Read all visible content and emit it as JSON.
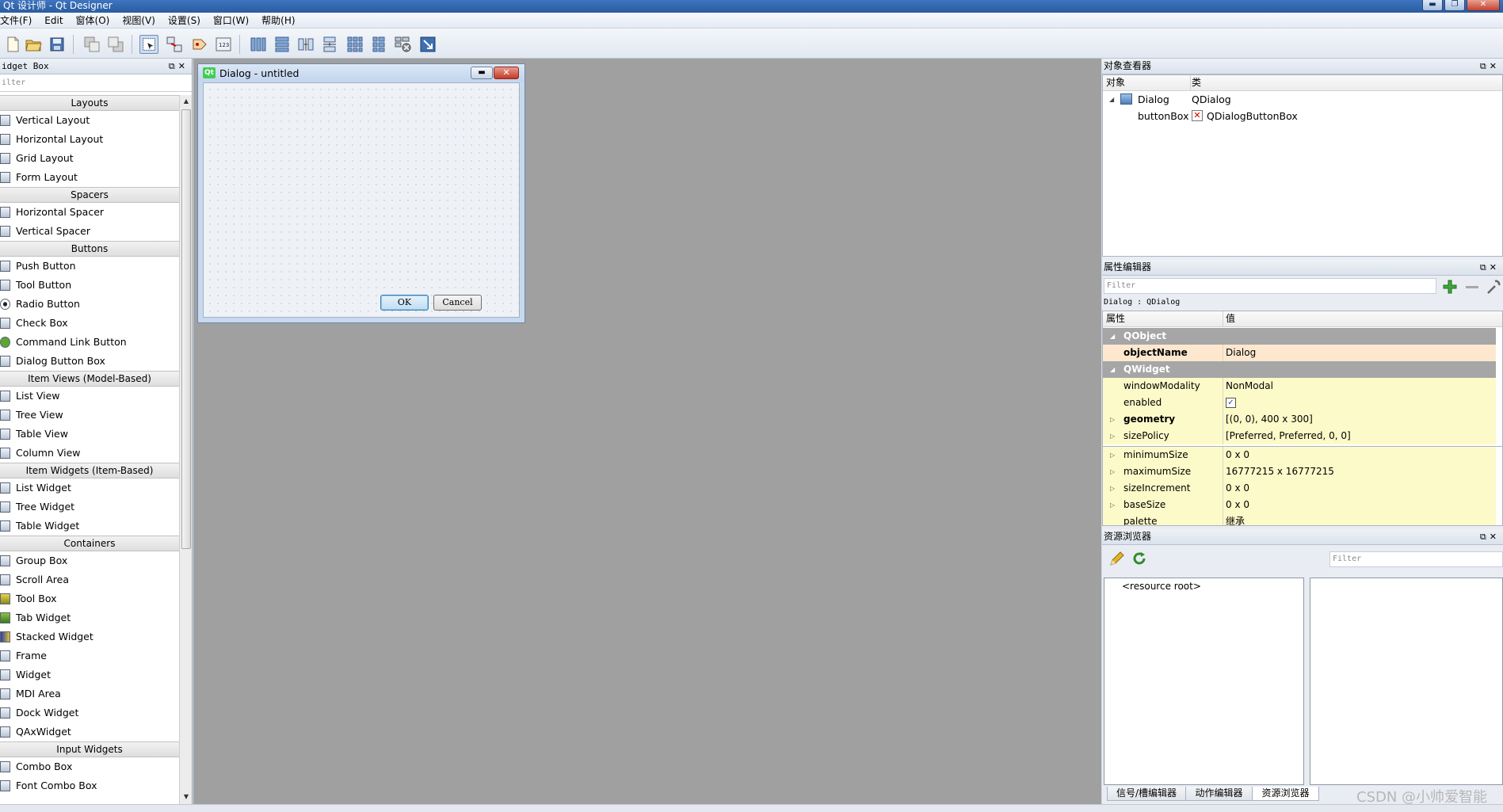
{
  "window": {
    "title": "Qt 设计师 - Qt Designer"
  },
  "menu": [
    "文件(F)",
    "Edit",
    "窗体(O)",
    "视图(V)",
    "设置(S)",
    "窗口(W)",
    "帮助(H)"
  ],
  "widget_box": {
    "title": "idget Box",
    "filter_placeholder": "ilter",
    "categories": [
      {
        "name": "Layouts",
        "items": [
          "Vertical Layout",
          "Horizontal Layout",
          "Grid Layout",
          "Form Layout"
        ]
      },
      {
        "name": "Spacers",
        "items": [
          "Horizontal Spacer",
          "Vertical Spacer"
        ]
      },
      {
        "name": "Buttons",
        "items": [
          "Push Button",
          "Tool Button",
          "Radio Button",
          "Check Box",
          "Command Link Button",
          "Dialog Button Box"
        ]
      },
      {
        "name": "Item Views (Model-Based)",
        "items": [
          "List View",
          "Tree View",
          "Table View",
          "Column View"
        ]
      },
      {
        "name": "Item Widgets (Item-Based)",
        "items": [
          "List Widget",
          "Tree Widget",
          "Table Widget"
        ]
      },
      {
        "name": "Containers",
        "items": [
          "Group Box",
          "Scroll Area",
          "Tool Box",
          "Tab Widget",
          "Stacked Widget",
          "Frame",
          "Widget",
          "MDI Area",
          "Dock Widget",
          "QAxWidget"
        ]
      },
      {
        "name": "Input Widgets",
        "items": [
          "Combo Box",
          "Font Combo Box"
        ]
      }
    ]
  },
  "dialog": {
    "title": "Dialog - untitled",
    "ok_label": "OK",
    "cancel_label": "Cancel",
    "logo_text": "Qt"
  },
  "object_inspector": {
    "title": "对象查看器",
    "col_object": "对象",
    "col_class": "类",
    "rows": [
      {
        "object": "Dialog",
        "class": "QDialog"
      },
      {
        "object": "buttonBox",
        "class": "QDialogButtonBox"
      }
    ]
  },
  "property_editor": {
    "title": "属性编辑器",
    "filter_placeholder": "Filter",
    "context": "Dialog : QDialog",
    "col_property": "属性",
    "col_value": "值",
    "groups": [
      {
        "name": "QObject",
        "props": [
          {
            "name": "objectName",
            "value": "Dialog"
          }
        ]
      },
      {
        "name": "QWidget",
        "props": [
          {
            "name": "windowModality",
            "value": "NonModal"
          },
          {
            "name": "enabled",
            "value": ""
          },
          {
            "name": "geometry",
            "value": "[(0, 0), 400 x 300]"
          },
          {
            "name": "sizePolicy",
            "value": "[Preferred, Preferred, 0, 0]"
          },
          {
            "name": "minimumSize",
            "value": "0 x 0"
          },
          {
            "name": "maximumSize",
            "value": "16777215 x 16777215"
          },
          {
            "name": "sizeIncrement",
            "value": "0 x 0"
          },
          {
            "name": "baseSize",
            "value": "0 x 0"
          },
          {
            "name": "palette",
            "value": "继承"
          }
        ]
      }
    ]
  },
  "resource_browser": {
    "title": "资源浏览器",
    "filter_placeholder": "Filter",
    "root_label": "<resource root>",
    "tabs": [
      "信号/槽编辑器",
      "动作编辑器",
      "资源浏览器"
    ]
  },
  "watermark": "CSDN @小帅爱智能"
}
